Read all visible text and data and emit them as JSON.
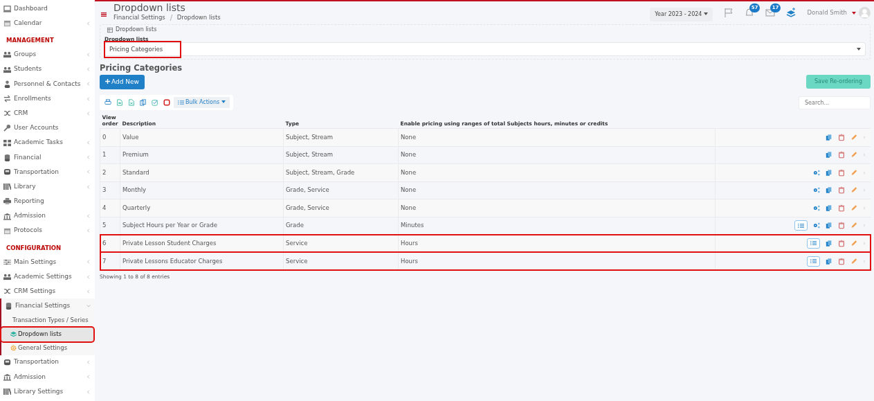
{
  "sidebar": [
    {
      "kind": "item",
      "label": "Dashboard",
      "submenu": false
    },
    {
      "kind": "item",
      "label": "Calendar",
      "submenu": true
    },
    {
      "kind": "heading",
      "label": "MANAGEMENT"
    },
    {
      "kind": "item",
      "label": "Groups",
      "submenu": true
    },
    {
      "kind": "item",
      "label": "Students",
      "submenu": true
    },
    {
      "kind": "item",
      "label": "Personnel & Contacts",
      "submenu": true
    },
    {
      "kind": "item",
      "label": "Enrollments",
      "submenu": true
    },
    {
      "kind": "item",
      "label": "CRM",
      "submenu": true
    },
    {
      "kind": "item",
      "label": "User Accounts",
      "submenu": false
    },
    {
      "kind": "item",
      "label": "Academic Tasks",
      "submenu": true
    },
    {
      "kind": "item",
      "label": "Financial",
      "submenu": true
    },
    {
      "kind": "item",
      "label": "Transportation",
      "submenu": true
    },
    {
      "kind": "item",
      "label": "Library",
      "submenu": true
    },
    {
      "kind": "item",
      "label": "Reporting",
      "submenu": false
    },
    {
      "kind": "item",
      "label": "Admission",
      "submenu": true
    },
    {
      "kind": "item",
      "label": "Protocols",
      "submenu": true
    },
    {
      "kind": "heading",
      "label": "CONFIGURATION"
    },
    {
      "kind": "item",
      "label": "Main Settings",
      "submenu": true
    },
    {
      "kind": "item",
      "label": "Academic Settings",
      "submenu": true
    },
    {
      "kind": "item",
      "label": "CRM Settings",
      "submenu": true
    },
    {
      "kind": "item",
      "label": "Financial Settings",
      "submenu": true,
      "expanded": true,
      "children": [
        {
          "label": "Transaction Types / Series",
          "selected": false,
          "highlighted": false
        },
        {
          "label": "Dropdown lists",
          "selected": true,
          "highlighted": true
        },
        {
          "label": "General Settings",
          "selected": false,
          "highlighted": false
        }
      ]
    },
    {
      "kind": "item",
      "label": "Transportation",
      "submenu": true
    },
    {
      "kind": "item",
      "label": "Admission",
      "submenu": true
    },
    {
      "kind": "item",
      "label": "Library Settings",
      "submenu": true
    }
  ],
  "header": {
    "title": "Dropdown lists",
    "breadcrumb": [
      "Financial Settings",
      "Dropdown lists"
    ],
    "year": "Year 2023 - 2024",
    "notifications": "57",
    "messages": "17",
    "user": "Donald Smith"
  },
  "panel": {
    "legend": "Dropdown lists",
    "field_label": "Dropdown lists",
    "value": "Pricing Categories",
    "highlighted": true
  },
  "section_title": "Pricing Categories",
  "add_button": "Add New",
  "save_button": {
    "label": "Save Re-ordering",
    "disabled": true
  },
  "bulk_actions": "Bulk Actions",
  "search": {
    "placeholder": "Search..."
  },
  "table": {
    "columns": [
      "View order",
      "Description",
      "Type",
      "Enable pricing using ranges of total Subjects hours, minutes or credits"
    ],
    "rows": [
      {
        "cells": [
          "0",
          "Value",
          "Subject, Stream",
          "None"
        ],
        "list_button": false,
        "settings": false,
        "highlighted": false
      },
      {
        "cells": [
          "1",
          "Premium",
          "Subject, Stream",
          "None"
        ],
        "list_button": false,
        "settings": false,
        "highlighted": false
      },
      {
        "cells": [
          "2",
          "Standard",
          "Subject, Stream, Grade",
          "None"
        ],
        "list_button": false,
        "settings": true,
        "highlighted": false
      },
      {
        "cells": [
          "3",
          "Monthly",
          "Grade, Service",
          "None"
        ],
        "list_button": false,
        "settings": true,
        "highlighted": false
      },
      {
        "cells": [
          "4",
          "Quarterly",
          "Grade, Service",
          "None"
        ],
        "list_button": false,
        "settings": true,
        "highlighted": false
      },
      {
        "cells": [
          "5",
          "Subject Hours per Year or Grade",
          "Grade",
          "Minutes"
        ],
        "list_button": true,
        "settings": true,
        "highlighted": false
      },
      {
        "cells": [
          "6",
          "Private Lesson Student Charges",
          "Service",
          "Hours"
        ],
        "list_button": true,
        "settings": false,
        "highlighted": true
      },
      {
        "cells": [
          "7",
          "Private Lessons Educator Charges",
          "Service",
          "Hours"
        ],
        "list_button": true,
        "settings": false,
        "highlighted": true
      }
    ]
  },
  "footer": "Showing 1 to 8 of 8 entries"
}
